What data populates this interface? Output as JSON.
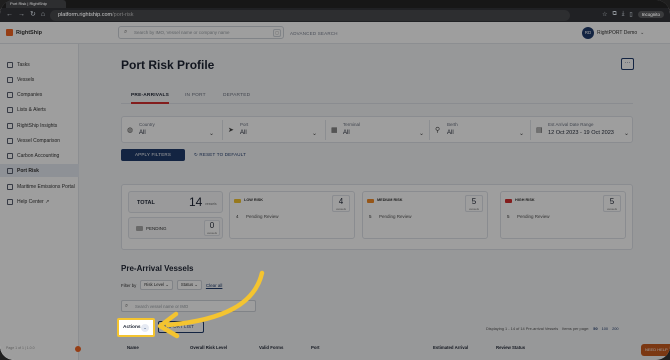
{
  "browser": {
    "tab_title": "Port Risk | RightShip",
    "url_host": "platform.rightship.com",
    "url_path": "/port-risk",
    "profile_label": "Incognito"
  },
  "app": {
    "logo_text": "RightShip",
    "search_placeholder": "Search by IMO, Vessel name or company name",
    "advanced_search": "ADVANCED SEARCH",
    "user_initials": "RD",
    "user_name": "RightPORT Demo"
  },
  "sidebar": {
    "items": [
      {
        "label": "Tasks",
        "icon": "tasks-icon"
      },
      {
        "label": "Vessels",
        "icon": "vessel-icon"
      },
      {
        "label": "Companies",
        "icon": "company-icon"
      },
      {
        "label": "Lists & Alerts",
        "icon": "alert-icon"
      },
      {
        "label": "RightShip Insights",
        "icon": "insights-icon"
      },
      {
        "label": "Vessel Comparison",
        "icon": "compare-icon"
      },
      {
        "label": "Carbon Accounting",
        "icon": "carbon-icon"
      },
      {
        "label": "Port Risk",
        "icon": "port-risk-icon"
      },
      {
        "label": "Maritime Emissions Portal",
        "icon": "emissions-icon"
      },
      {
        "label": "Help Center ↗",
        "icon": "help-icon"
      }
    ],
    "footer": "Page 1 of 1 | 1.0.0"
  },
  "page": {
    "title": "Port Risk Profile",
    "more_button": "···",
    "tabs": [
      "PRE-ARRIVALS",
      "IN PORT",
      "DEPARTED"
    ]
  },
  "filters": {
    "country": {
      "label": "Country",
      "value": "All"
    },
    "port": {
      "label": "Port",
      "value": "All"
    },
    "terminal": {
      "label": "Terminal",
      "value": "All"
    },
    "berth": {
      "label": "Berth",
      "value": "All"
    },
    "eta": {
      "label": "Est Arrival Date Range",
      "value": "12 Oct 2023 - 19 Oct 2023"
    },
    "apply_label": "APPLY FILTERS",
    "reset_label": "RESET TO DEFAULT"
  },
  "summary": {
    "total_label": "TOTAL",
    "total_value": "14",
    "total_unit": "vessels",
    "pending_label": "PENDING",
    "pending_value": "0",
    "pending_unit": "vessels",
    "cards": [
      {
        "title": "LOW RISK",
        "count": "4",
        "unit": "vessels",
        "pending_count": "4",
        "pending_label": "Pending Review",
        "color": "#f4c430"
      },
      {
        "title": "MEDIUM RISK",
        "count": "5",
        "unit": "vessels",
        "pending_count": "5",
        "pending_label": "Pending Review",
        "color": "#f28c28"
      },
      {
        "title": "HIGH RISK",
        "count": "5",
        "unit": "vessels",
        "pending_count": "5",
        "pending_label": "Pending Review",
        "color": "#d32f2f"
      }
    ]
  },
  "vessels": {
    "heading": "Pre-Arrival Vessels",
    "filter_by": "Filter by",
    "risk_level_dd": "Risk Level ⌄",
    "status_dd": "Status ⌄",
    "clear_all": "Clear all",
    "search_placeholder": "Search vessel name or IMO",
    "actions_label": "Actions",
    "actions_chevron": "⌄",
    "export_label": "EXPORT LIST",
    "paging_text": "Displaying 1 - 14 of 14 Pre-arrival Vessels",
    "items_per_page_label": "Items per page:",
    "page_sizes": [
      "50",
      "100",
      "200"
    ],
    "columns": [
      "Name",
      "Overall Risk Level",
      "Valid Forms",
      "Port",
      "Estimated Arrival",
      "Review Status"
    ]
  },
  "chat_label": "NEED HELP"
}
